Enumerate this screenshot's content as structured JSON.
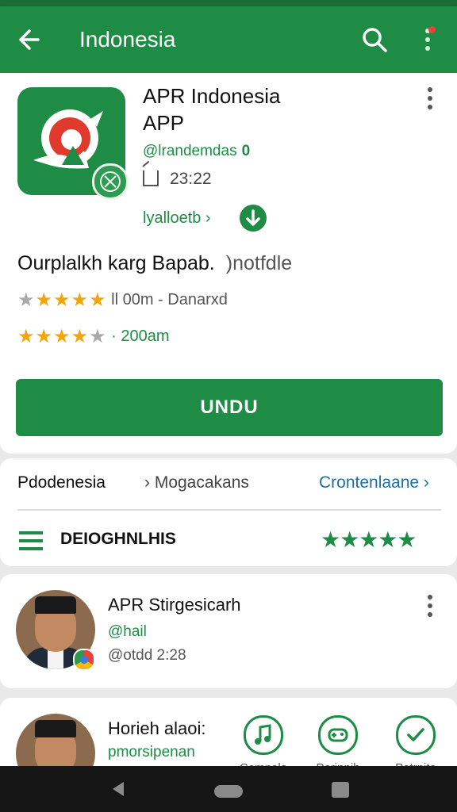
{
  "appbar": {
    "title": "Indonesia"
  },
  "app": {
    "name_line1": "APR Indonesia",
    "name_line2": "APP",
    "developer": "@lrandemdas",
    "developer_badge": "0",
    "size_time": "23:22",
    "install_link": "lyalloetb ›",
    "headline": "Ourplalkh karg Bapab.",
    "headline_note": ")notfdle",
    "rating1": {
      "stars": 4,
      "text": "ll 00m - Danarxd"
    },
    "rating2": {
      "stars": 4.5,
      "text": "· 200am"
    },
    "install_button": "UNDU"
  },
  "tabs": {
    "tab1": "Pdodenesia",
    "tab2": "› Mogacakans",
    "tab3": "Crontenlaane ›",
    "category_label": "DEIOGHNLHIS",
    "category_stars": "★★★★★"
  },
  "reviews": [
    {
      "name": "APR Stirgesicarh",
      "handle": "@hail",
      "time": "@otdd 2:28"
    },
    {
      "name": "Horieh alaoi:",
      "handle": "pmorsipenan"
    }
  ],
  "actions": [
    {
      "label": "Cemnala",
      "icon": "music-note-icon"
    },
    {
      "label": "Porinnih",
      "icon": "gamepad-icon"
    },
    {
      "label": "Petrnite",
      "icon": "check-circle-icon"
    }
  ],
  "colors": {
    "brand_green": "#1e8c45",
    "star_gold": "#f3a50d",
    "link_blue": "#1d6fa8"
  }
}
